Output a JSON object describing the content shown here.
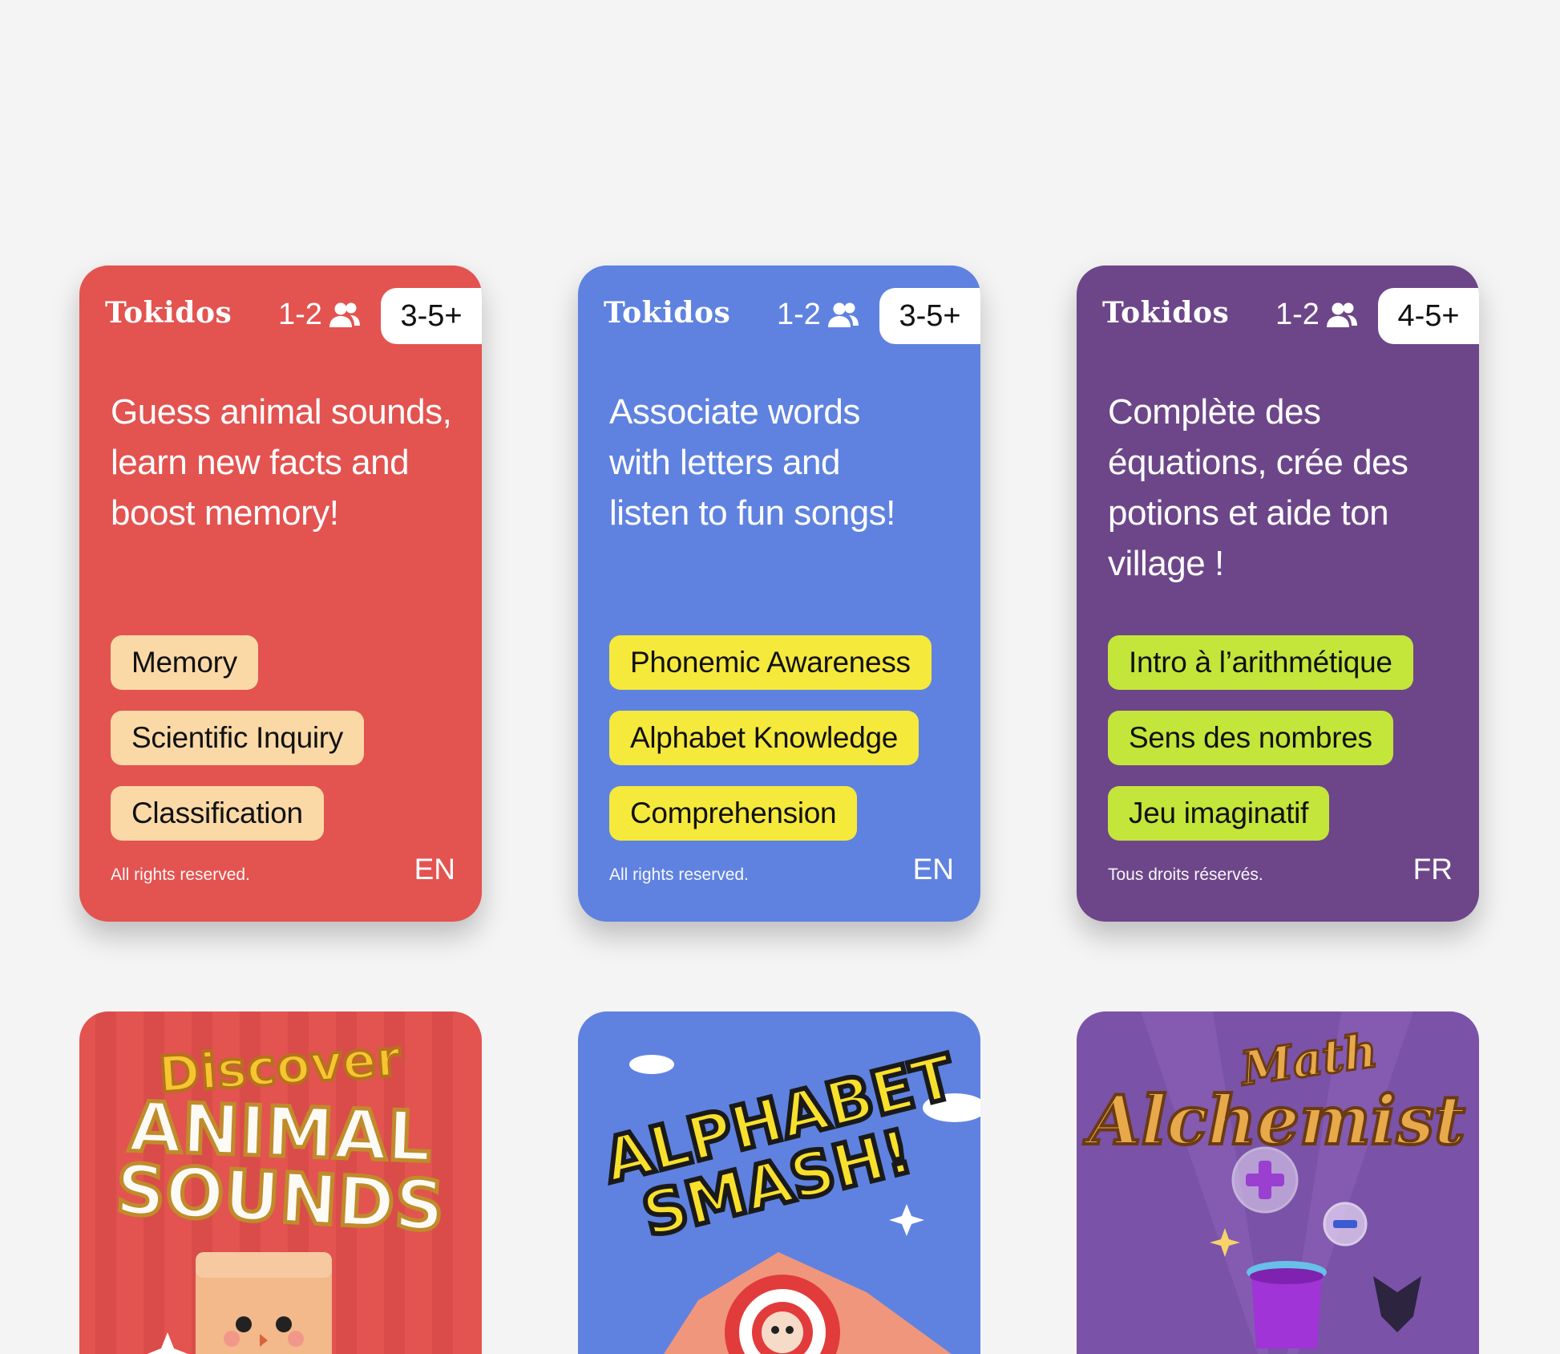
{
  "colors": {
    "page_bg": "#f4f4f4",
    "card_red": "#e35350",
    "card_blue": "#5f82e0",
    "card_purple": "#6d4689",
    "tag_peach": "#fbd9a6",
    "tag_yellow": "#f5e93c",
    "tag_lime": "#c4e53a"
  },
  "cards": [
    {
      "brand": "Tokidos",
      "players": "1-2",
      "players_icon": "people-icon",
      "age": "3-5+",
      "description": "Guess animal sounds, learn new facts and boost memory!",
      "tags": [
        "Memory",
        "Scientific Inquiry",
        "Classification"
      ],
      "rights": "All rights reserved.",
      "lang": "EN"
    },
    {
      "brand": "Tokidos",
      "players": "1-2",
      "players_icon": "people-icon",
      "age": "3-5+",
      "description": "Associate words with letters and listen to fun songs!",
      "tags": [
        "Phonemic Awareness",
        "Alphabet Knowledge",
        "Comprehension"
      ],
      "rights": "All rights reserved.",
      "lang": "EN"
    },
    {
      "brand": "Tokidos",
      "players": "1-2",
      "players_icon": "people-icon",
      "age": "4-5+",
      "description": "Complète des équations, crée des potions et aide ton village !",
      "tags": [
        "Intro à l’arithmétique",
        "Sens des nombres",
        "Jeu imaginatif"
      ],
      "rights": "Tous droits réservés.",
      "lang": "FR"
    }
  ],
  "art": [
    {
      "line1": "Discover",
      "line2": "ANIMAL",
      "line3": "SOUNDS"
    },
    {
      "line1": "ALPHABET",
      "line2": "SMASH!"
    },
    {
      "line1": "Math",
      "line2": "Alchemist"
    }
  ]
}
